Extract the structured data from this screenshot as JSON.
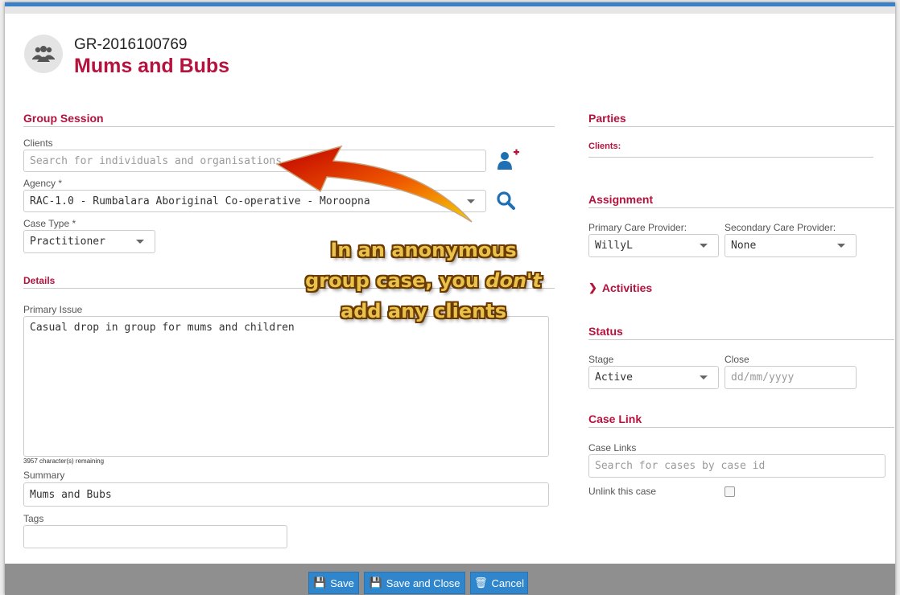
{
  "header": {
    "case_id": "GR-2016100769",
    "case_name": "Mums and Bubs",
    "avatar_icon": "group-icon"
  },
  "group_session": {
    "title": "Group Session",
    "clients_label": "Clients",
    "clients_placeholder": "Search for individuals and organisations",
    "agency_label": "Agency *",
    "agency_value": "RAC-1.0 - Rumbalara Aboriginal Co-operative - Moroopna",
    "case_type_label": "Case Type *",
    "case_type_value": "Practitioner"
  },
  "details": {
    "title": "Details",
    "primary_issue_label": "Primary Issue",
    "primary_issue_value": "Casual drop in group for mums and children",
    "remaining": "3957 character(s) remaining",
    "summary_label": "Summary",
    "summary_value": "Mums and Bubs",
    "tags_label": "Tags",
    "tags_value": ""
  },
  "parties": {
    "title": "Parties",
    "clients_label": "Clients:"
  },
  "assignment": {
    "title": "Assignment",
    "primary_label": "Primary Care Provider:",
    "primary_value": "WillyL",
    "secondary_label": "Secondary Care Provider:",
    "secondary_value": "None"
  },
  "activities": {
    "title": "Activities"
  },
  "status": {
    "title": "Status",
    "stage_label": "Stage",
    "stage_value": "Active",
    "close_label": "Close",
    "close_placeholder": "dd/mm/yyyy"
  },
  "case_link": {
    "title": "Case Link",
    "links_label": "Case Links",
    "links_placeholder": "Search for cases by case id",
    "unlink_label": "Unlink this case"
  },
  "footer": {
    "save": "Save",
    "save_close": "Save and Close",
    "cancel": "Cancel"
  },
  "annotation": {
    "line1": "In an anonymous",
    "line2_pre": "group case, you ",
    "line2_em": "don't",
    "line3": "add any clients"
  },
  "colors": {
    "accent": "#b5123e",
    "primary_button": "#2f86cc",
    "icon": "#1f6fb5"
  }
}
